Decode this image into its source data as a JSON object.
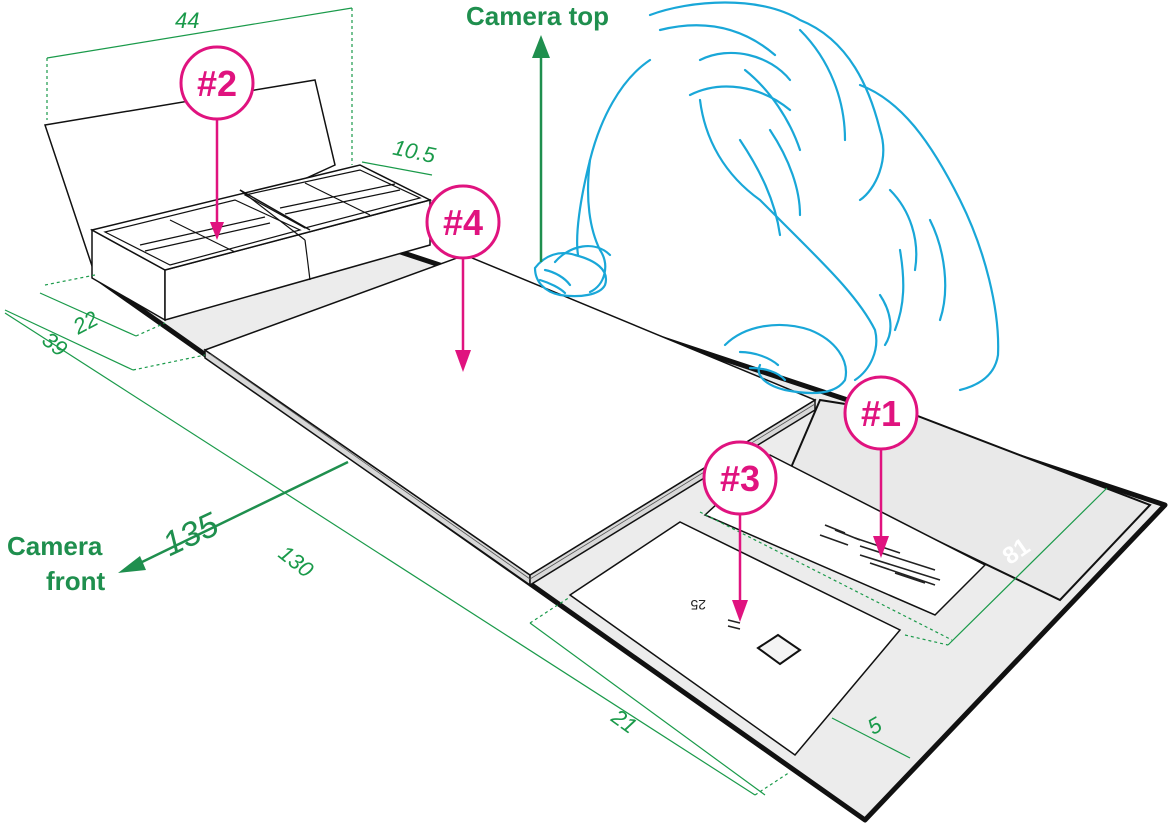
{
  "colors": {
    "callout": "#e0137f",
    "dimension": "#1a9a4a",
    "camera_axis": "#1f8f4e",
    "person": "#19a7d8",
    "outline": "#111111",
    "board_fill": "#ececec"
  },
  "camera": {
    "top_label": "Camera top",
    "front_label_line1": "Camera",
    "front_label_line2": "front",
    "front_distance": "135"
  },
  "dimensions": {
    "tray_width": "44",
    "tray_depth": "10.5",
    "left_22": "22",
    "left_39": "39",
    "board_length": "130",
    "card_width": "21",
    "card_offset": "5"
  },
  "callouts": {
    "c1": "#1",
    "c2": "#2",
    "c3": "#3",
    "c4": "#4"
  },
  "card": {
    "mirrored_text": "25",
    "corner_mark": "81"
  }
}
